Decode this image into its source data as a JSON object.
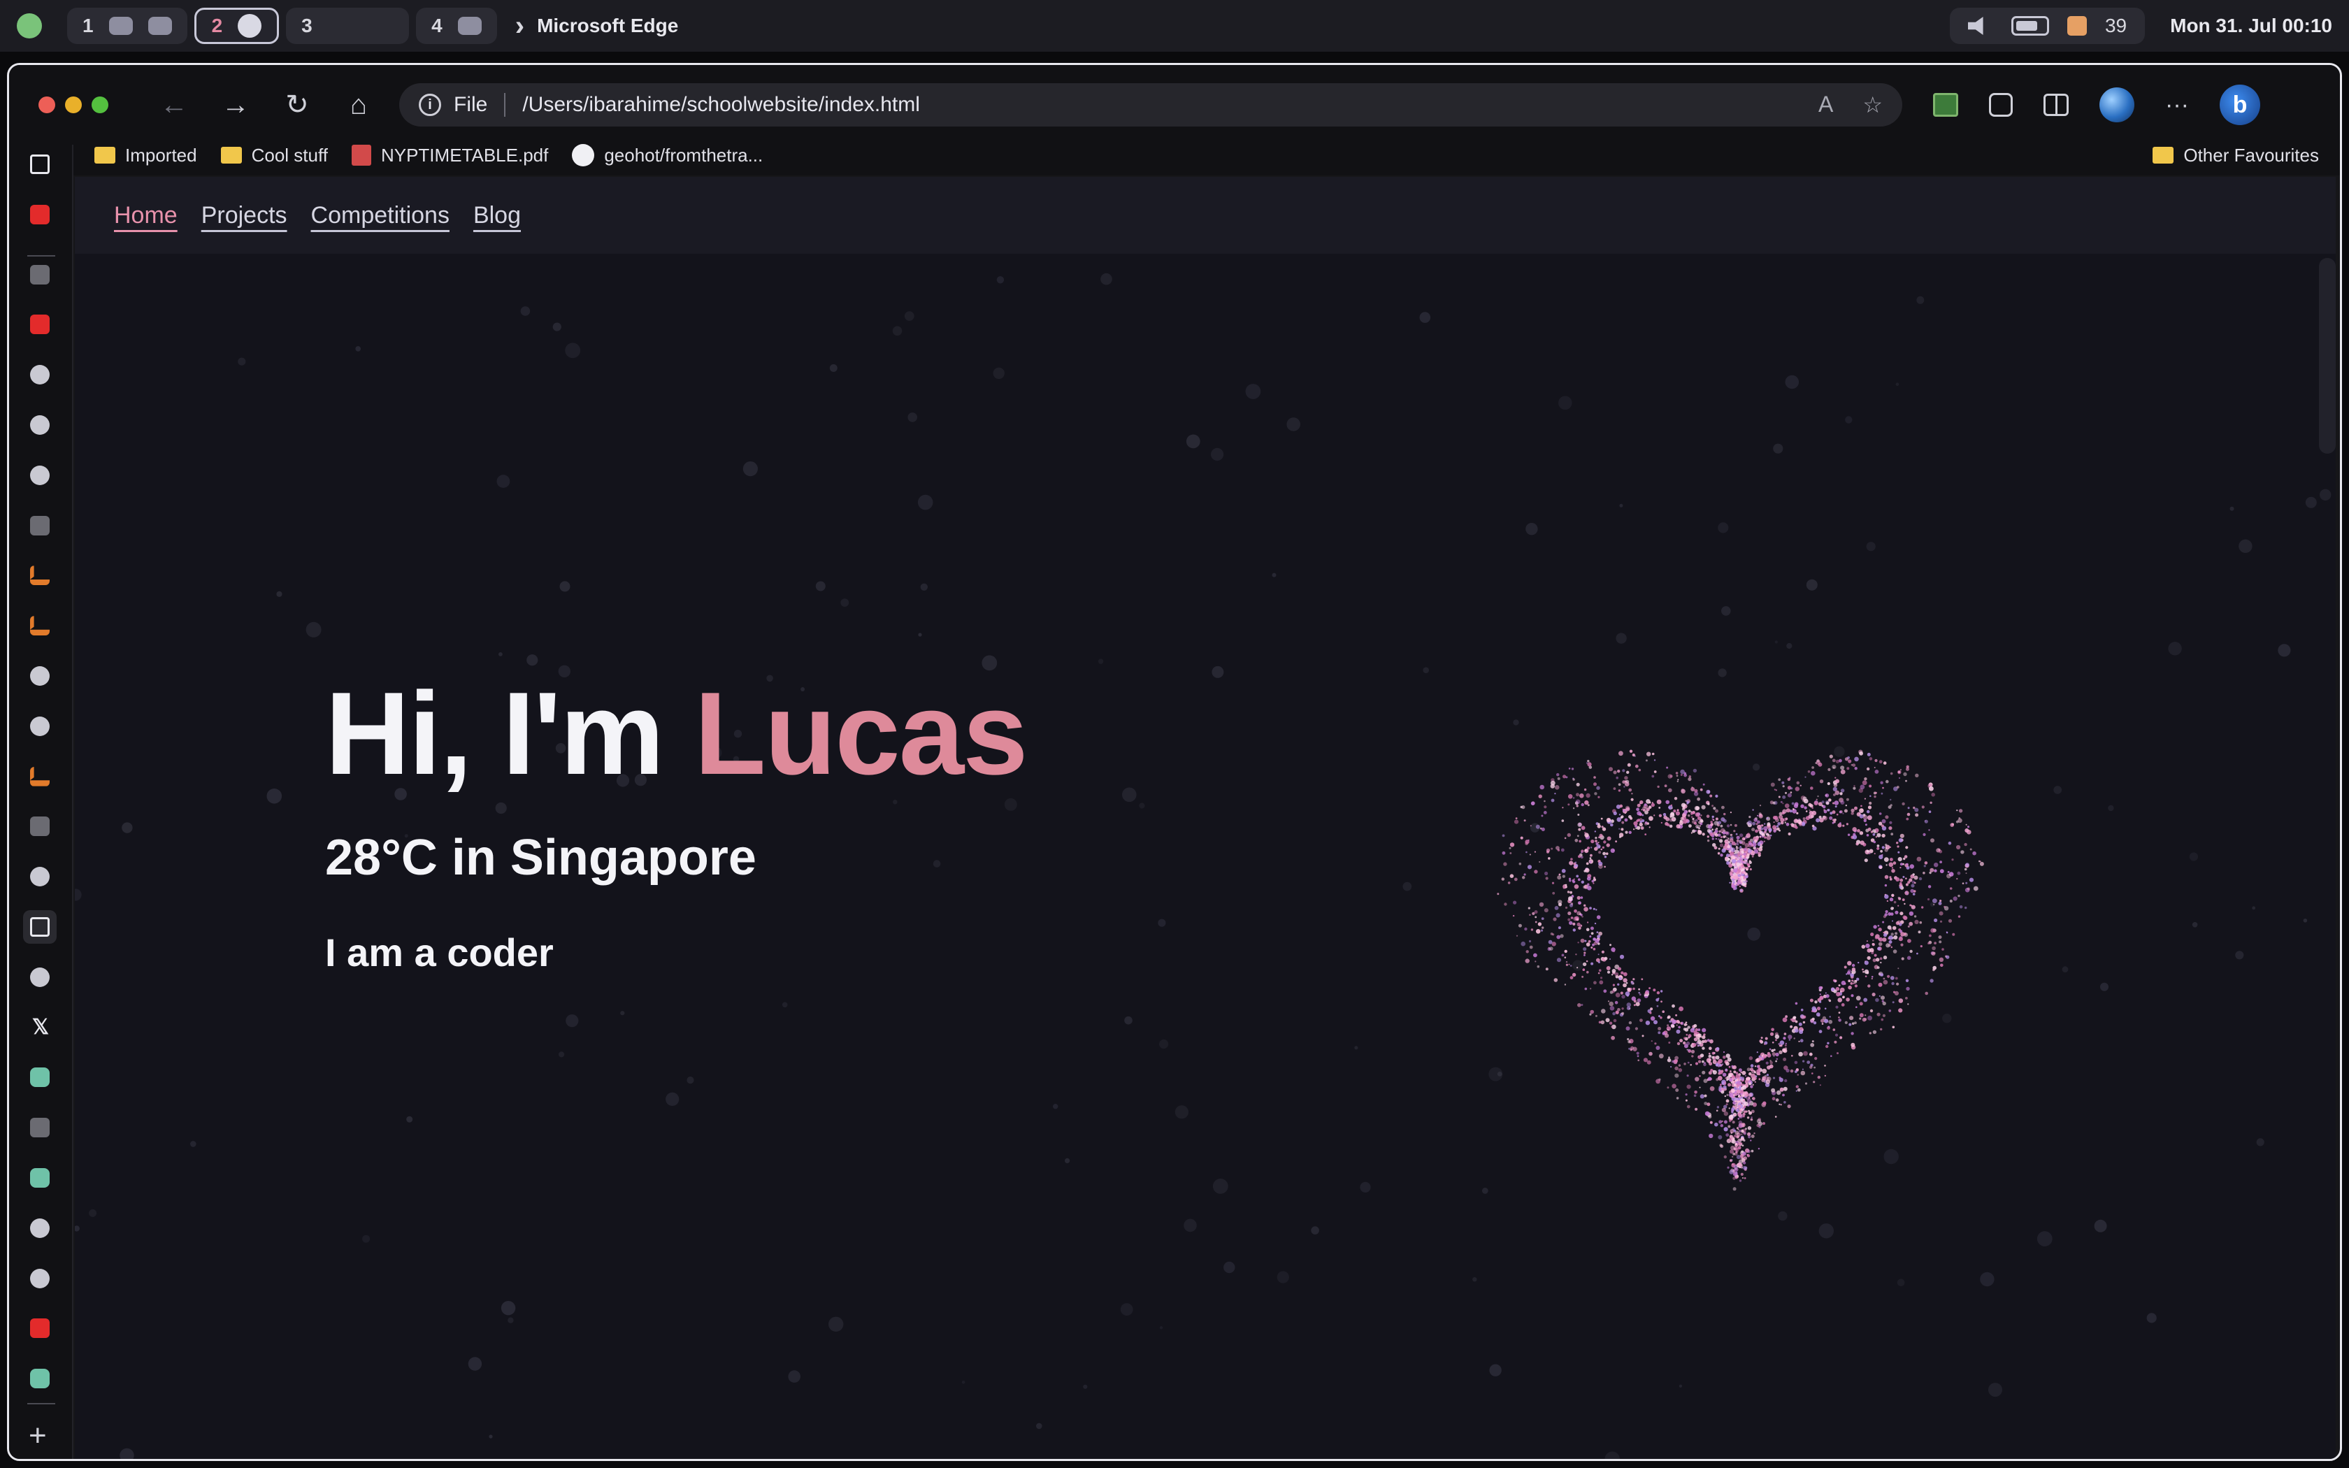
{
  "menubar": {
    "workspaces": [
      {
        "num": "1",
        "active": false
      },
      {
        "num": "2",
        "active": true
      },
      {
        "num": "3",
        "active": false
      },
      {
        "num": "4",
        "active": false
      }
    ],
    "app_name": "Microsoft Edge",
    "status_count": "39",
    "clock": "Mon 31. Jul  00:10"
  },
  "browser": {
    "scheme_label": "File",
    "url": "/Users/ibarahime/schoolwebsite/index.html",
    "favourites": [
      "Imported",
      "Cool stuff",
      "NYPTIMETABLE.pdf",
      "geohot/fromthetra..."
    ],
    "other_favourites": "Other Favourites",
    "sidebar_tabs": [
      "tabs",
      "youtube",
      "chrome",
      "youtube",
      "github",
      "github",
      "github",
      "apple",
      "stackoverflow",
      "stackoverflow",
      "github",
      "github",
      "stackoverflow",
      "openai",
      "github",
      "page",
      "github",
      "x",
      "chatgpt",
      "wikipedia",
      "feather",
      "github",
      "github",
      "youtube",
      "android"
    ]
  },
  "site": {
    "nav": [
      "Home",
      "Projects",
      "Competitions",
      "Blog"
    ],
    "greeting_prefix": "Hi, I'm ",
    "greeting_name": "Lucas",
    "weather": "28°C in Singapore",
    "tagline": "I am a coder"
  },
  "colors": {
    "accent_pink": "#de8a9a",
    "page_bg": "#13131b",
    "nav_bg": "#1a1a23"
  }
}
